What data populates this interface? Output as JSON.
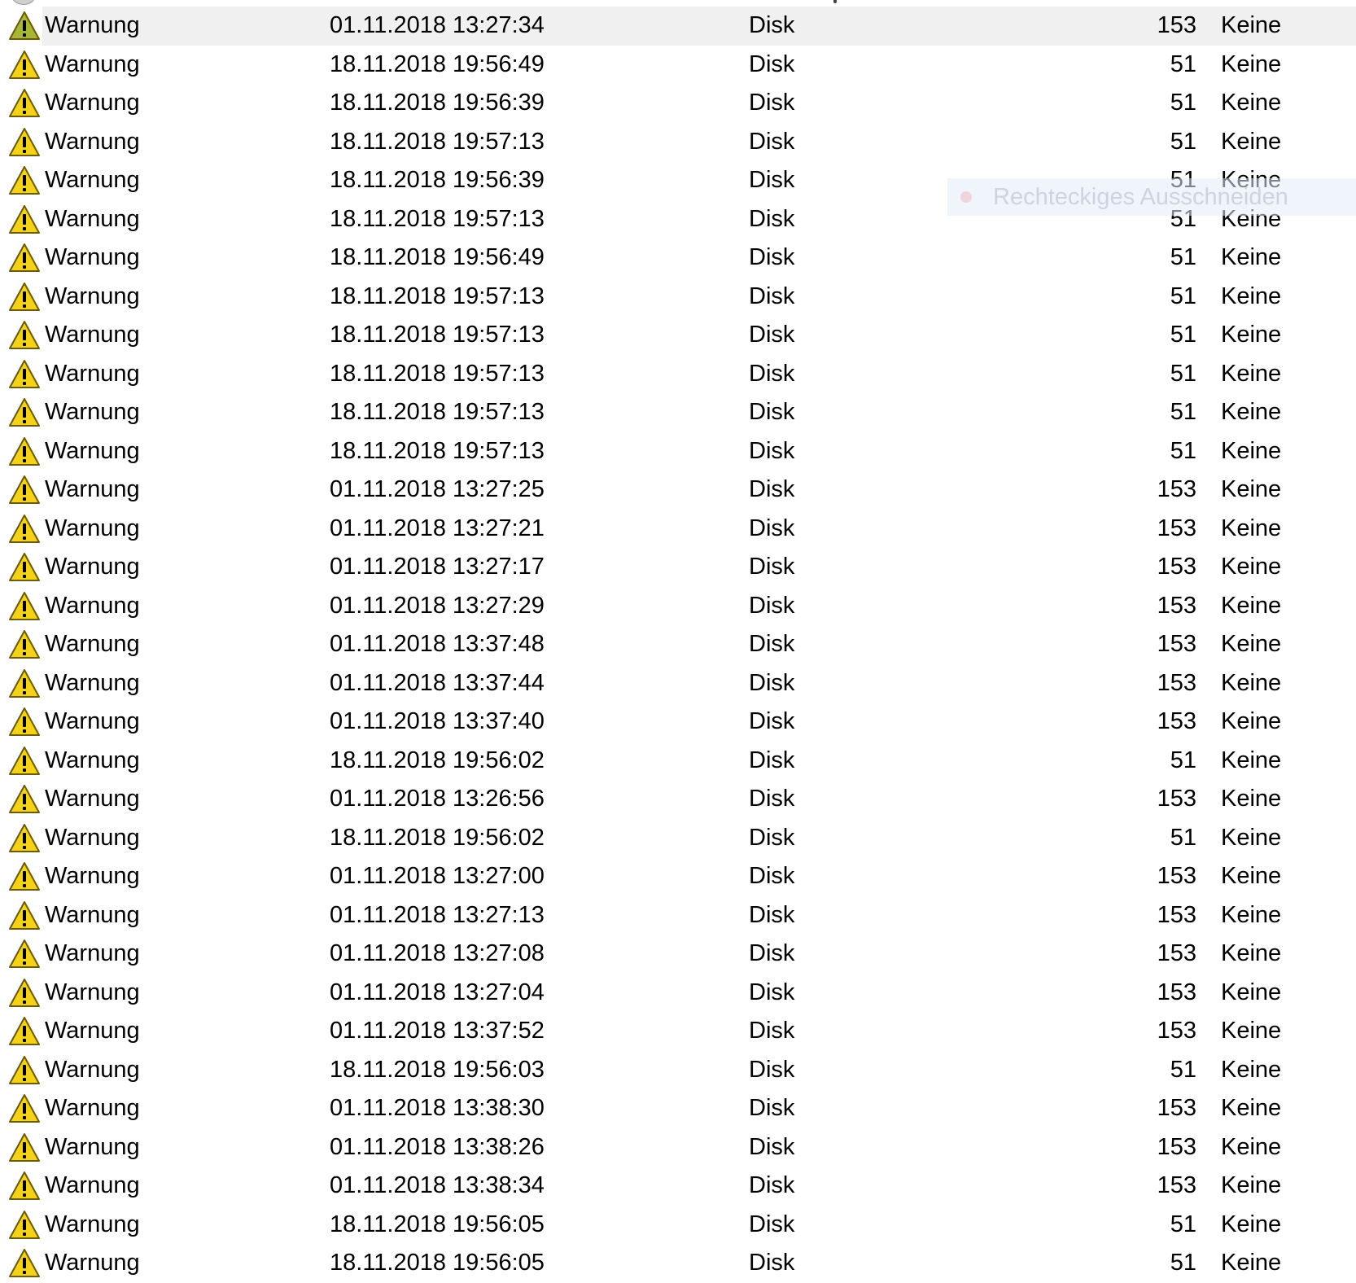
{
  "colors": {
    "warning_fill": "#f5d21a",
    "warning_fill_selected": "#a6b636",
    "warning_stroke": "#6b5a00",
    "selected_row_bg": "#f0f0f0"
  },
  "overlay": {
    "label": "Rechteckiges Ausschneiden",
    "icon": "record-dot-icon"
  },
  "events": [
    {
      "level": "Warnung",
      "datetime": "01.11.2018 13:27:34",
      "source": "Disk",
      "event_id": "153",
      "category": "Keine",
      "selected": true
    },
    {
      "level": "Warnung",
      "datetime": "18.11.2018 19:56:49",
      "source": "Disk",
      "event_id": "51",
      "category": "Keine"
    },
    {
      "level": "Warnung",
      "datetime": "18.11.2018 19:56:39",
      "source": "Disk",
      "event_id": "51",
      "category": "Keine"
    },
    {
      "level": "Warnung",
      "datetime": "18.11.2018 19:57:13",
      "source": "Disk",
      "event_id": "51",
      "category": "Keine"
    },
    {
      "level": "Warnung",
      "datetime": "18.11.2018 19:56:39",
      "source": "Disk",
      "event_id": "51",
      "category": "Keine"
    },
    {
      "level": "Warnung",
      "datetime": "18.11.2018 19:57:13",
      "source": "Disk",
      "event_id": "51",
      "category": "Keine"
    },
    {
      "level": "Warnung",
      "datetime": "18.11.2018 19:56:49",
      "source": "Disk",
      "event_id": "51",
      "category": "Keine"
    },
    {
      "level": "Warnung",
      "datetime": "18.11.2018 19:57:13",
      "source": "Disk",
      "event_id": "51",
      "category": "Keine"
    },
    {
      "level": "Warnung",
      "datetime": "18.11.2018 19:57:13",
      "source": "Disk",
      "event_id": "51",
      "category": "Keine"
    },
    {
      "level": "Warnung",
      "datetime": "18.11.2018 19:57:13",
      "source": "Disk",
      "event_id": "51",
      "category": "Keine"
    },
    {
      "level": "Warnung",
      "datetime": "18.11.2018 19:57:13",
      "source": "Disk",
      "event_id": "51",
      "category": "Keine"
    },
    {
      "level": "Warnung",
      "datetime": "18.11.2018 19:57:13",
      "source": "Disk",
      "event_id": "51",
      "category": "Keine"
    },
    {
      "level": "Warnung",
      "datetime": "01.11.2018 13:27:25",
      "source": "Disk",
      "event_id": "153",
      "category": "Keine"
    },
    {
      "level": "Warnung",
      "datetime": "01.11.2018 13:27:21",
      "source": "Disk",
      "event_id": "153",
      "category": "Keine"
    },
    {
      "level": "Warnung",
      "datetime": "01.11.2018 13:27:17",
      "source": "Disk",
      "event_id": "153",
      "category": "Keine"
    },
    {
      "level": "Warnung",
      "datetime": "01.11.2018 13:27:29",
      "source": "Disk",
      "event_id": "153",
      "category": "Keine"
    },
    {
      "level": "Warnung",
      "datetime": "01.11.2018 13:37:48",
      "source": "Disk",
      "event_id": "153",
      "category": "Keine"
    },
    {
      "level": "Warnung",
      "datetime": "01.11.2018 13:37:44",
      "source": "Disk",
      "event_id": "153",
      "category": "Keine"
    },
    {
      "level": "Warnung",
      "datetime": "01.11.2018 13:37:40",
      "source": "Disk",
      "event_id": "153",
      "category": "Keine"
    },
    {
      "level": "Warnung",
      "datetime": "18.11.2018 19:56:02",
      "source": "Disk",
      "event_id": "51",
      "category": "Keine"
    },
    {
      "level": "Warnung",
      "datetime": "01.11.2018 13:26:56",
      "source": "Disk",
      "event_id": "153",
      "category": "Keine"
    },
    {
      "level": "Warnung",
      "datetime": "18.11.2018 19:56:02",
      "source": "Disk",
      "event_id": "51",
      "category": "Keine"
    },
    {
      "level": "Warnung",
      "datetime": "01.11.2018 13:27:00",
      "source": "Disk",
      "event_id": "153",
      "category": "Keine"
    },
    {
      "level": "Warnung",
      "datetime": "01.11.2018 13:27:13",
      "source": "Disk",
      "event_id": "153",
      "category": "Keine"
    },
    {
      "level": "Warnung",
      "datetime": "01.11.2018 13:27:08",
      "source": "Disk",
      "event_id": "153",
      "category": "Keine"
    },
    {
      "level": "Warnung",
      "datetime": "01.11.2018 13:27:04",
      "source": "Disk",
      "event_id": "153",
      "category": "Keine"
    },
    {
      "level": "Warnung",
      "datetime": "01.11.2018 13:37:52",
      "source": "Disk",
      "event_id": "153",
      "category": "Keine"
    },
    {
      "level": "Warnung",
      "datetime": "18.11.2018 19:56:03",
      "source": "Disk",
      "event_id": "51",
      "category": "Keine"
    },
    {
      "level": "Warnung",
      "datetime": "01.11.2018 13:38:30",
      "source": "Disk",
      "event_id": "153",
      "category": "Keine"
    },
    {
      "level": "Warnung",
      "datetime": "01.11.2018 13:38:26",
      "source": "Disk",
      "event_id": "153",
      "category": "Keine"
    },
    {
      "level": "Warnung",
      "datetime": "01.11.2018 13:38:34",
      "source": "Disk",
      "event_id": "153",
      "category": "Keine"
    },
    {
      "level": "Warnung",
      "datetime": "18.11.2018 19:56:05",
      "source": "Disk",
      "event_id": "51",
      "category": "Keine"
    },
    {
      "level": "Warnung",
      "datetime": "18.11.2018 19:56:05",
      "source": "Disk",
      "event_id": "51",
      "category": "Keine"
    }
  ]
}
